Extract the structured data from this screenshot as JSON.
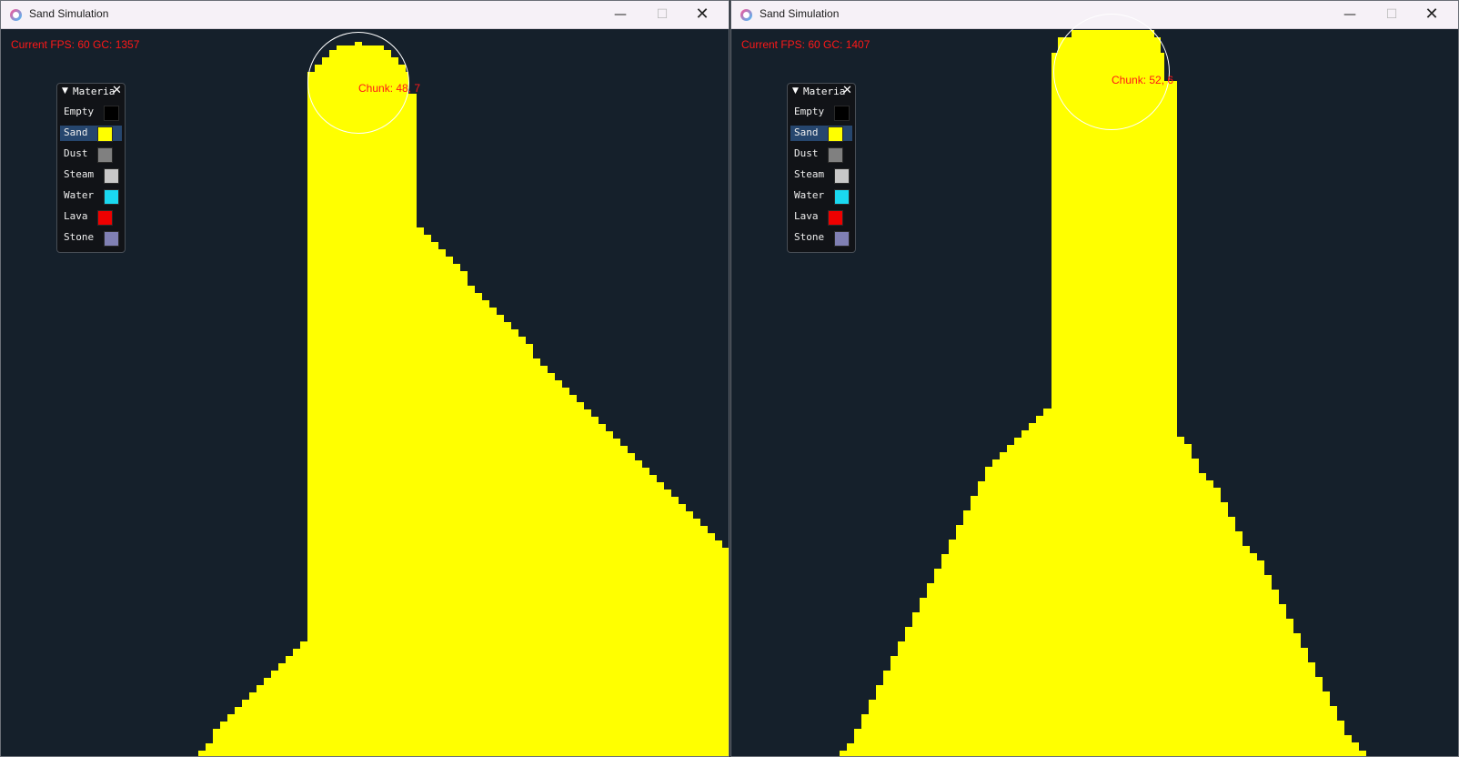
{
  "windows": [
    {
      "title": "Sand Simulation",
      "hud_text": "Current FPS: 60 GC: 1357",
      "chunk_label": "Chunk: 48, 7",
      "controls": {
        "minimize": "—",
        "maximize": "☐",
        "close": "✕"
      },
      "panel": {
        "title": "Materials",
        "collapse_icon": "▼",
        "close_icon": "✕",
        "selected": "Sand",
        "items": [
          {
            "label": "Empty",
            "color": "#000000"
          },
          {
            "label": "Sand",
            "color": "#ffff00"
          },
          {
            "label": "Dust",
            "color": "#808080"
          },
          {
            "label": "Steam",
            "color": "#c8c8c8"
          },
          {
            "label": "Water",
            "color": "#1ad8f0"
          },
          {
            "label": "Lava",
            "color": "#ee0000"
          },
          {
            "label": "Stone",
            "color": "#8080b4"
          }
        ]
      }
    },
    {
      "title": "Sand Simulation",
      "hud_text": "Current FPS: 60 GC: 1407",
      "chunk_label": "Chunk: 52, 6",
      "controls": {
        "minimize": "—",
        "maximize": "☐",
        "close": "✕"
      },
      "panel": {
        "title": "Materials",
        "collapse_icon": "▼",
        "close_icon": "✕",
        "selected": "Sand",
        "items": [
          {
            "label": "Empty",
            "color": "#000000"
          },
          {
            "label": "Sand",
            "color": "#ffff00"
          },
          {
            "label": "Dust",
            "color": "#808080"
          },
          {
            "label": "Steam",
            "color": "#c8c8c8"
          },
          {
            "label": "Water",
            "color": "#1ad8f0"
          },
          {
            "label": "Lava",
            "color": "#ee0000"
          },
          {
            "label": "Stone",
            "color": "#8080b4"
          }
        ]
      }
    }
  ],
  "colors": {
    "background": "#15202b",
    "sand": "#ffff00",
    "hud_text": "#ff1818",
    "brush": "#ffffff"
  }
}
